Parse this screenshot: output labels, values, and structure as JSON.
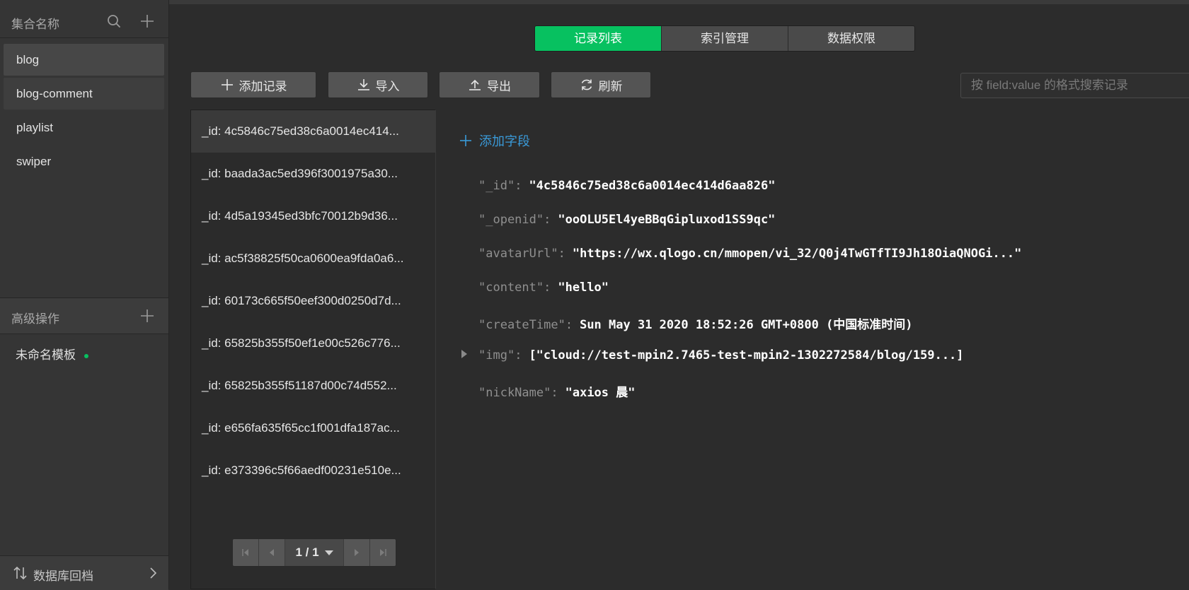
{
  "sidebar": {
    "header_title": "集合名称",
    "collections": [
      {
        "label": "blog"
      },
      {
        "label": "blog-comment"
      },
      {
        "label": "playlist"
      },
      {
        "label": "swiper"
      }
    ],
    "advanced_title": "高级操作",
    "template_label": "未命名模板",
    "footer_label": "数据库回档"
  },
  "tabs": [
    {
      "label": "记录列表",
      "active": true
    },
    {
      "label": "索引管理"
    },
    {
      "label": "数据权限"
    }
  ],
  "toolbar": {
    "add_record": "添加记录",
    "import": "导入",
    "export": "导出",
    "refresh": "刷新",
    "search_placeholder": "按 field:value 的格式搜索记录"
  },
  "records": [
    "_id: 4c5846c75ed38c6a0014ec414...",
    "_id: baada3ac5ed396f3001975a30...",
    "_id: 4d5a19345ed3bfc70012b9d36...",
    "_id: ac5f38825f50ca0600ea9fda0a6...",
    "_id: 60173c665f50eef300d0250d7d...",
    "_id: 65825b355f50ef1e00c526c776...",
    "_id: 65825b355f51187d00c74d552...",
    "_id: e656fa635f65cc1f001dfa187ac...",
    "_id: e373396c5f66aedf00231e510e..."
  ],
  "pagination": {
    "label": "1 / 1"
  },
  "detail": {
    "add_field_label": "添加字段",
    "fields": [
      {
        "key": "\"_id\"",
        "value": "\"4c5846c75ed38c6a0014ec414d6aa826\""
      },
      {
        "key": "\"_openid\"",
        "value": "\"ooOLU5El4yeBBqGipluxod1SS9qc\""
      },
      {
        "key": "\"avatarUrl\"",
        "value": "\"https://wx.qlogo.cn/mmopen/vi_32/Q0j4TwGTfTI9Jh18OiaQNOGi...\""
      },
      {
        "key": "\"content\"",
        "value": "\"hello\""
      },
      {
        "key": "\"createTime\"",
        "value": "Sun May 31 2020 18:52:26 GMT+0800 (中国标准时间)"
      },
      {
        "key": "\"img\"",
        "value": "[\"cloud://test-mpin2.7465-test-mpin2-1302272584/blog/159...]"
      },
      {
        "key": "\"nickName\"",
        "value": "\"axios 晨\""
      }
    ]
  },
  "colors": {
    "accent": "#07c160",
    "link": "#3a9ad9",
    "background": "#2c2c2c"
  }
}
